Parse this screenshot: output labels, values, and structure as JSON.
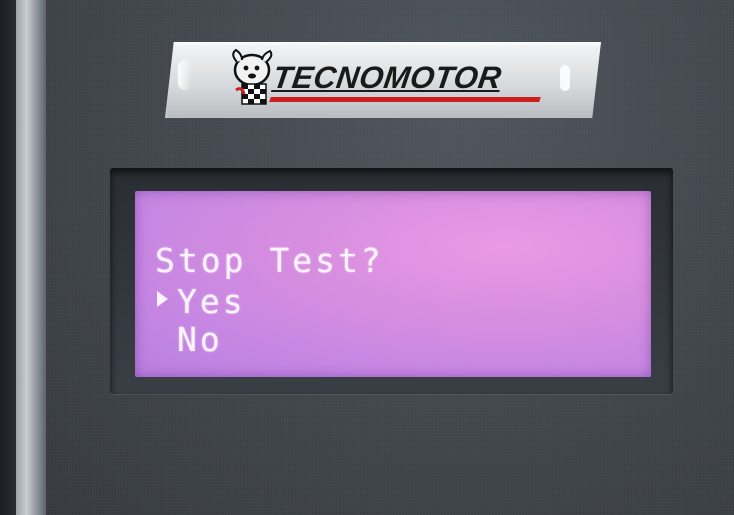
{
  "device": {
    "brand": "TECNOMOTOR",
    "colors": {
      "panel": "#43484f",
      "lcd_background": "#d98fe0",
      "lcd_text": "#fbf4ff",
      "logo_stripe": "#cc1f1f"
    }
  },
  "lcd": {
    "prompt": "Stop Test?",
    "cursor_icon": "selection-triangle-icon",
    "options": [
      {
        "label": "Yes",
        "selected": true
      },
      {
        "label": "No",
        "selected": false
      }
    ]
  }
}
